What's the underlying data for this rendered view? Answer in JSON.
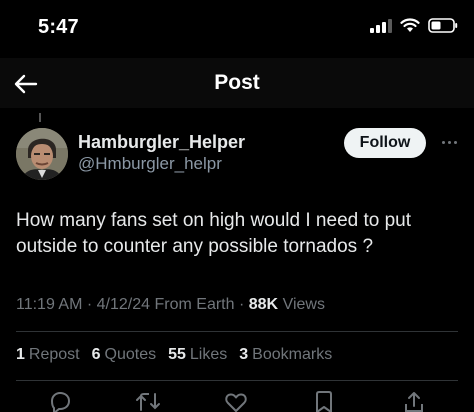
{
  "status_bar": {
    "time": "5:47"
  },
  "nav": {
    "title": "Post"
  },
  "author": {
    "display_name": "Hamburgler_Helper",
    "handle": "@Hmburgler_helpr",
    "follow_label": "Follow"
  },
  "post": {
    "text": "How many fans set on high would I need to put outside to counter any possible tornados ?",
    "time": "11:19 AM",
    "date": "4/12/24",
    "source": "From Earth",
    "views_count": "88K",
    "views_label": "Views"
  },
  "stats": {
    "reposts": {
      "count": "1",
      "label": "Repost"
    },
    "quotes": {
      "count": "6",
      "label": "Quotes"
    },
    "likes": {
      "count": "55",
      "label": "Likes"
    },
    "bookmarks": {
      "count": "3",
      "label": "Bookmarks"
    }
  },
  "icons": {
    "back": "arrow-left-icon",
    "reply": "reply-icon",
    "repost": "repost-icon",
    "like": "heart-icon",
    "bookmark": "bookmark-icon",
    "share": "share-icon"
  },
  "colors": {
    "background": "#000000",
    "primary_text": "#e7e9ea",
    "secondary_text": "#71767b",
    "follow_bg": "#eff3f4"
  }
}
